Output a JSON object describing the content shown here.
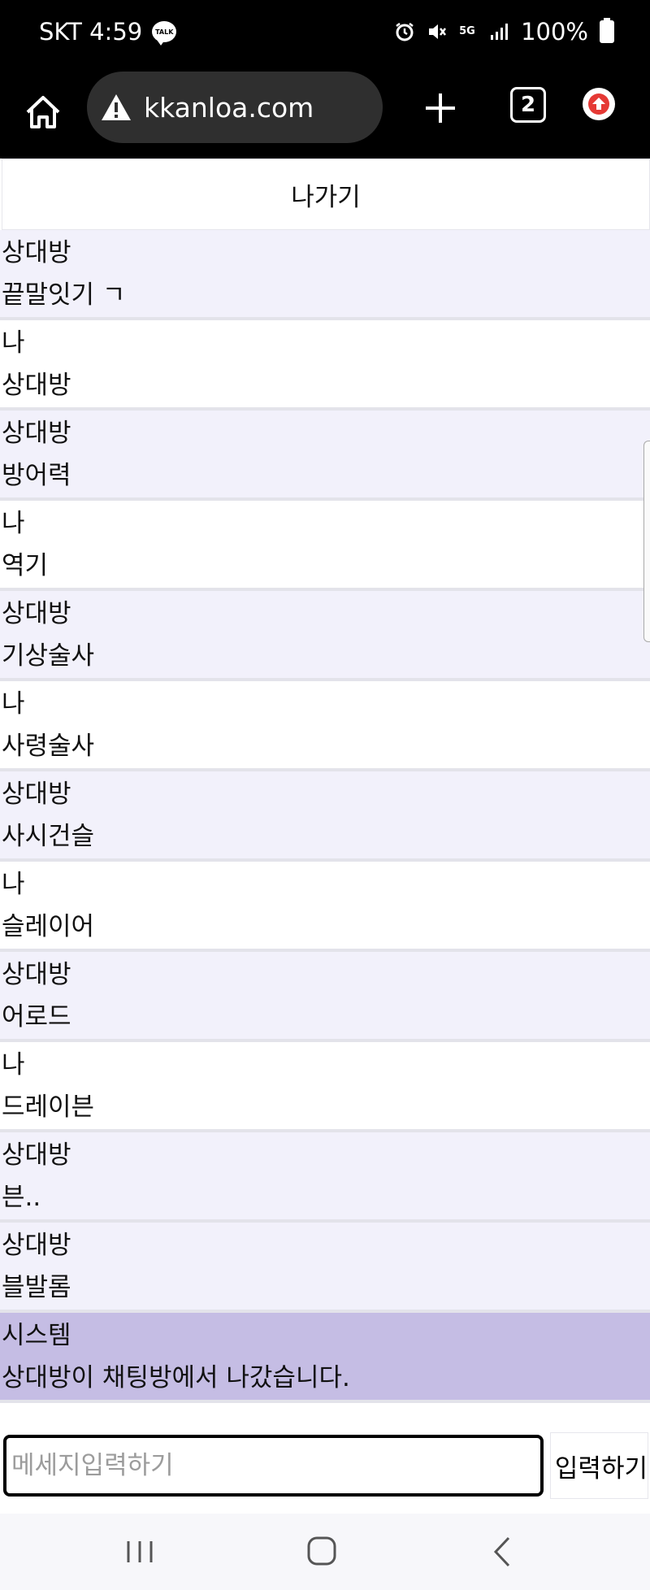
{
  "status_bar": {
    "carrier_time": "SKT 4:59",
    "talk_label": "TALK",
    "network": "5G",
    "battery": "100%"
  },
  "browser": {
    "url": "kkanloa.com",
    "tab_count": "2"
  },
  "chat": {
    "exit_label": "나가기",
    "messages": [
      {
        "sender": "상대방",
        "text": "끝말잇기 ㄱ",
        "role": "opponent"
      },
      {
        "sender": "나",
        "text": "상대방",
        "role": "me"
      },
      {
        "sender": "상대방",
        "text": "방어력",
        "role": "opponent"
      },
      {
        "sender": "나",
        "text": "역기",
        "role": "me"
      },
      {
        "sender": "상대방",
        "text": "기상술사",
        "role": "opponent"
      },
      {
        "sender": "나",
        "text": "사령술사",
        "role": "me"
      },
      {
        "sender": "상대방",
        "text": "사시건슬",
        "role": "opponent"
      },
      {
        "sender": "나",
        "text": "슬레이어",
        "role": "me"
      },
      {
        "sender": "상대방",
        "text": "어로드",
        "role": "opponent"
      },
      {
        "sender": "나",
        "text": "드레이븐",
        "role": "me"
      },
      {
        "sender": "상대방",
        "text": "븐..",
        "role": "opponent"
      },
      {
        "sender": "상대방",
        "text": "블발롬",
        "role": "opponent"
      },
      {
        "sender": "시스템",
        "text": "상대방이 채팅방에서 나갔습니다.",
        "role": "system"
      }
    ],
    "input_placeholder": "메세지입력하기",
    "input_value": "",
    "send_label": "입력하기"
  },
  "colors": {
    "opponent_bg": "#f2f1fb",
    "me_bg": "#ffffff",
    "system_bg": "#c5bde4",
    "update_red": "#e53935"
  }
}
